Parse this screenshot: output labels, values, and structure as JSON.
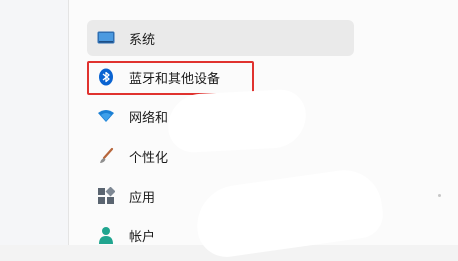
{
  "nav": [
    {
      "label": "系统",
      "icon": "monitor-icon",
      "selected": true
    },
    {
      "label": "蓝牙和其他设备",
      "icon": "bluetooth-icon",
      "selected": false,
      "highlighted": true
    },
    {
      "label": "网络和",
      "icon": "wifi-icon",
      "selected": false
    },
    {
      "label": "个性化",
      "icon": "brush-icon",
      "selected": false
    },
    {
      "label": "应用",
      "icon": "apps-icon",
      "selected": false
    },
    {
      "label": "帐户",
      "icon": "user-icon",
      "selected": false
    }
  ],
  "colors": {
    "accent": "#0a63d1",
    "highlight": "#e0322f"
  }
}
